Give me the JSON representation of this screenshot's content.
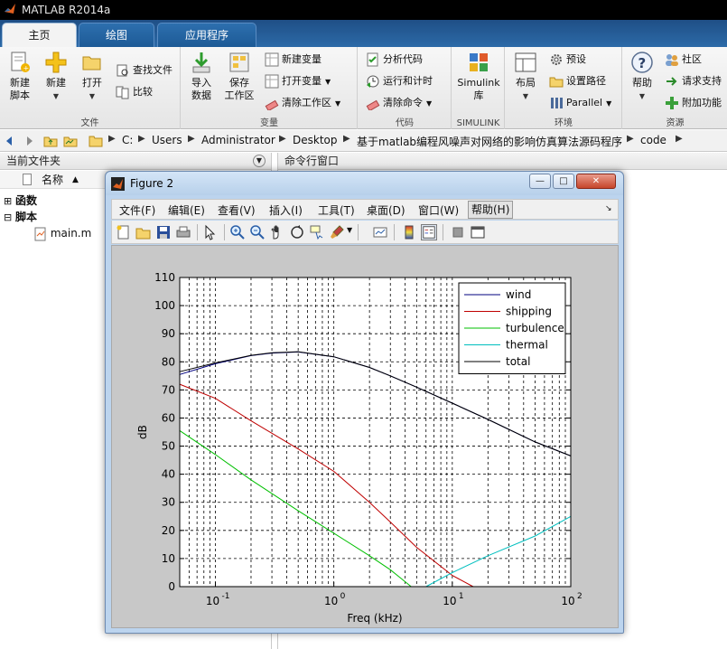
{
  "app": {
    "title": "MATLAB R2014a"
  },
  "tabs": [
    {
      "label": "主页",
      "active": true
    },
    {
      "label": "绘图",
      "active": false
    },
    {
      "label": "应用程序",
      "active": false
    }
  ],
  "ribbon": {
    "file": {
      "group_label": "文件",
      "new_script": "新建\n脚本",
      "new": "新建",
      "open": "打开",
      "find_files": "查找文件",
      "compare": "比较"
    },
    "variable": {
      "group_label": "变量",
      "import_data": "导入\n数据",
      "save_workspace": "保存\n工作区",
      "new_variable": "新建变量",
      "open_variable": "打开变量",
      "clear_workspace": "清除工作区"
    },
    "code": {
      "group_label": "代码",
      "analyze_code": "分析代码",
      "run_and_time": "运行和计时",
      "clear_commands": "清除命令"
    },
    "simulink": {
      "group_label": "SIMULINK",
      "library": "Simulink\n库"
    },
    "environment": {
      "group_label": "环境",
      "layout": "布局",
      "preferences": "预设",
      "set_path": "设置路径",
      "parallel": "Parallel"
    },
    "resources": {
      "group_label": "资源",
      "help": "帮助",
      "community": "社区",
      "request_support": "请求支持",
      "add_ons": "附加功能"
    }
  },
  "address": {
    "crumbs": [
      "C:",
      "Users",
      "Administrator",
      "Desktop",
      "基于matlab编程风噪声对网络的影响仿真算法源码程序",
      "code"
    ]
  },
  "left_panel": {
    "title": "当前文件夹",
    "column_name": "名称",
    "items": [
      {
        "label": "函数",
        "expander": "⊞"
      },
      {
        "label": "脚本",
        "expander": "⊟"
      },
      {
        "label": "main.m"
      }
    ]
  },
  "right_panel": {
    "title": "命令行窗口"
  },
  "figure": {
    "title": "Figure 2",
    "buttons": {
      "minimize": "—",
      "maximize": "□",
      "close": "✕"
    },
    "menu": [
      {
        "label": "文件(F)"
      },
      {
        "label": "编辑(E)"
      },
      {
        "label": "查看(V)"
      },
      {
        "label": "插入(I)"
      },
      {
        "label": "工具(T)"
      },
      {
        "label": "桌面(D)"
      },
      {
        "label": "窗口(W)"
      },
      {
        "label": "帮助(H)"
      }
    ],
    "toolbar_icons": [
      "new-figure-icon",
      "open-file-icon",
      "save-icon",
      "print-icon",
      "pointer-icon",
      "zoom-in-icon",
      "zoom-out-icon",
      "pan-icon",
      "rotate-icon",
      "data-cursor-icon",
      "brush-icon",
      "link-icon",
      "colorbar-icon",
      "legend-icon",
      "hide-tools-icon",
      "dock-icon"
    ]
  },
  "chart_data": {
    "type": "line",
    "xlabel": "Freq (kHz)",
    "ylabel": "dB",
    "x_scale": "log",
    "xlim": [
      0.05,
      100
    ],
    "ylim": [
      0,
      110
    ],
    "x_ticks": [
      0.1,
      1,
      10,
      100
    ],
    "x_tick_labels": [
      "10",
      "10",
      "10",
      "10"
    ],
    "x_tick_exponents": [
      "-1",
      "0",
      "1",
      "2"
    ],
    "y_ticks": [
      0,
      10,
      20,
      30,
      40,
      50,
      60,
      70,
      80,
      90,
      100,
      110
    ],
    "y_tick_labels": [
      "0",
      "10",
      "20",
      "30",
      "40",
      "50",
      "60",
      "70",
      "80",
      "90",
      "100",
      "110"
    ],
    "grid": true,
    "legend_position": "top-right",
    "series": [
      {
        "name": "wind",
        "color": "#00007f",
        "x": [
          0.05,
          0.1,
          0.2,
          0.3,
          0.5,
          1,
          2,
          3,
          5,
          10,
          20,
          50,
          100
        ],
        "y": [
          75.5,
          79.3,
          82.2,
          83.1,
          83.5,
          81.8,
          78,
          75,
          71,
          65.3,
          59.5,
          51.5,
          46.5
        ]
      },
      {
        "name": "shipping",
        "color": "#bf0000",
        "x": [
          0.05,
          0.1,
          0.2,
          0.5,
          1,
          2,
          3,
          5,
          10,
          15
        ],
        "y": [
          72,
          67,
          59,
          49,
          41,
          30,
          23,
          14,
          4,
          0
        ]
      },
      {
        "name": "turbulence",
        "color": "#00bf00",
        "x": [
          0.05,
          0.1,
          0.2,
          0.5,
          1,
          2,
          3,
          4.5
        ],
        "y": [
          55.5,
          47,
          38,
          27,
          19,
          11,
          6,
          0
        ]
      },
      {
        "name": "thermal",
        "color": "#00bfbf",
        "x": [
          6,
          10,
          20,
          50,
          100
        ],
        "y": [
          0,
          5,
          11,
          18,
          25
        ]
      },
      {
        "name": "total",
        "color": "#000000",
        "x": [
          0.05,
          0.1,
          0.2,
          0.3,
          0.5,
          1,
          2,
          3,
          5,
          10,
          20,
          50,
          100
        ],
        "y": [
          76.5,
          79.6,
          82.3,
          83.2,
          83.6,
          81.8,
          78,
          75,
          71,
          65.3,
          59.5,
          51.5,
          46.5
        ]
      }
    ]
  }
}
